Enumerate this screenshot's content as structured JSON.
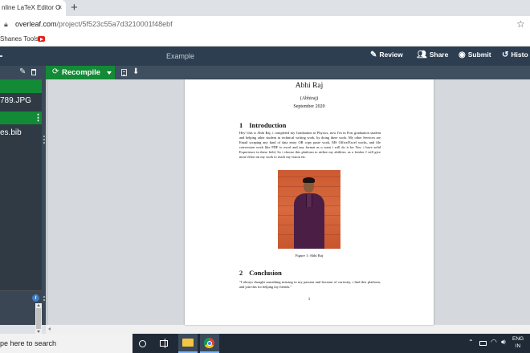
{
  "browser": {
    "tab_title": "nline LaTeX Editor O",
    "tab_close": "×",
    "new_tab": "+",
    "url_host": "overleaf.com",
    "url_path": "/project/5f523c55a7d3210001f48ebf",
    "bookmark_1": "Shanes Tools"
  },
  "toolbar": {
    "project_name": "Example",
    "review_label": "Review",
    "share_label": "Share",
    "submit_label": "Submit",
    "history_label": "Histo"
  },
  "editor": {
    "recompile_label": "Recompile"
  },
  "filetree": {
    "files": [
      "789.JPG",
      "es.bib"
    ]
  },
  "document": {
    "title": "Abhi Raj",
    "author": "(Abhiraj)",
    "date": "September 2020",
    "section1_num": "1",
    "section1_title": "Introduction",
    "paragraph1": "Hey! this is Abhi Raj, i completed my Graduation in Physics, now I'm in Post graduation student and helping other student in technical writing work, by doing there work. My other Services are Email scraping any kind of data entry OR copy paste work, MS Office/Excel works, and file conversion work like PDF to excel and any format as u want i will do it for You. i have solid Experience in these field, So i choose this platform to utilize my abilities. as a fresher I will give more effort on my work to reach my vision etc.",
    "figure_caption": "Figure 1: Abhi Raj",
    "section2_num": "2",
    "section2_title": "Conclusion",
    "paragraph2": "\"I always thought something missing in my passion and because of curiosity, i find this platform, and join this for helping my friends.\"",
    "page_number": "1"
  },
  "taskbar": {
    "search_text": "pe here to search",
    "lang_line1": "ENG",
    "lang_line2": "IN"
  },
  "colors": {
    "overleaf_toolbar": "#2c3e50",
    "overleaf_green": "#138a36",
    "taskbar": "#202a36"
  }
}
